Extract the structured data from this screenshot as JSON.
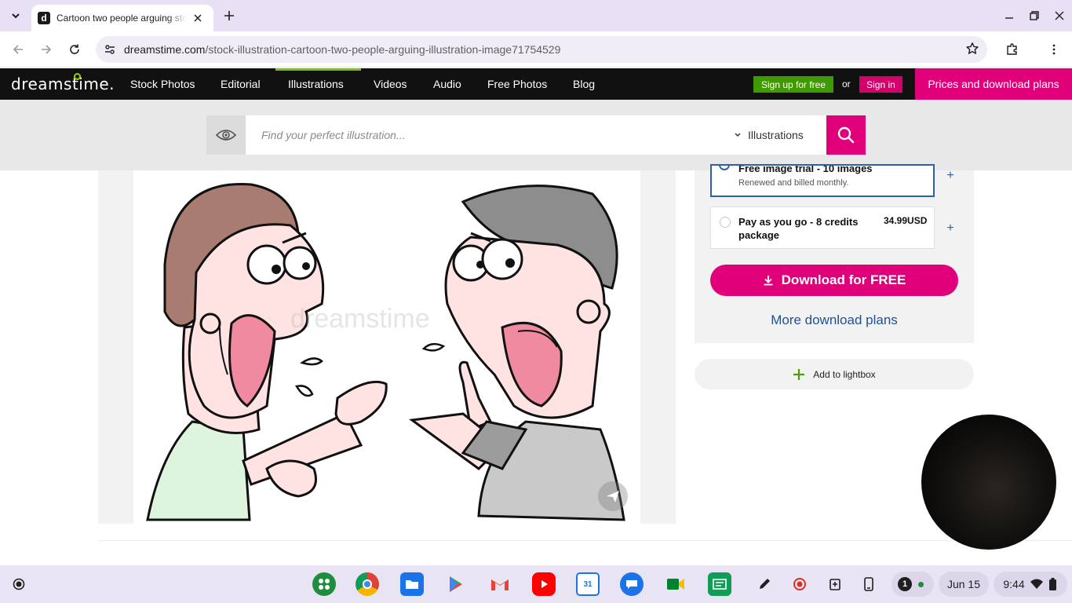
{
  "browser": {
    "tab_title": "Cartoon two people arguing stock illustration",
    "url_host": "dreamstime.com",
    "url_path": "/stock-illustration-cartoon-two-people-arguing-illustration-image71754529"
  },
  "site": {
    "logo": "dreamstime.",
    "nav": [
      "Stock Photos",
      "Editorial",
      "Illustrations",
      "Videos",
      "Audio",
      "Free Photos",
      "Blog"
    ],
    "active_nav": "Illustrations",
    "signup": "Sign up for free",
    "or": "or",
    "signin": "Sign in",
    "plans": "Prices and download plans",
    "accent": "#e0007a",
    "green": "#7cc200"
  },
  "search": {
    "placeholder": "Find your perfect illustration...",
    "category": "Illustrations"
  },
  "image": {
    "watermark": "dreamstime"
  },
  "plans": {
    "trial_title": "Free image trial - 10 images",
    "trial_sub": "Renewed and billed monthly.",
    "payg_title": "Pay as you go - 8 credits package",
    "payg_price": "34.99USD",
    "download": "Download for FREE",
    "more": "More download plans",
    "lightbox": "Add to lightbox"
  },
  "shelf": {
    "notifications": "1",
    "date": "Jun 15",
    "time": "9:44"
  }
}
